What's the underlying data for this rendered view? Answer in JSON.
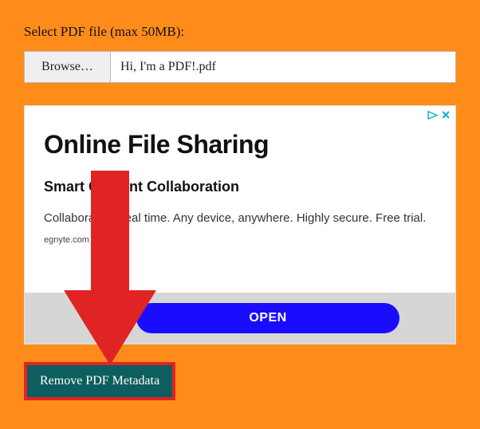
{
  "form": {
    "label": "Select PDF file (max 50MB):",
    "browse_label": "Browse…",
    "file_value": "Hi, I'm a PDF!.pdf"
  },
  "ad": {
    "title": "Online File Sharing",
    "subtitle": "Smart Content Collaboration",
    "body_line1": "Collaborate in real time. Any device, anywhere. Highly secure.",
    "body_line2": "Free trial.",
    "domain": "egnyte.com",
    "open_label": "OPEN",
    "close_glyph": "✕"
  },
  "action": {
    "button_label": "Remove PDF Metadata"
  }
}
